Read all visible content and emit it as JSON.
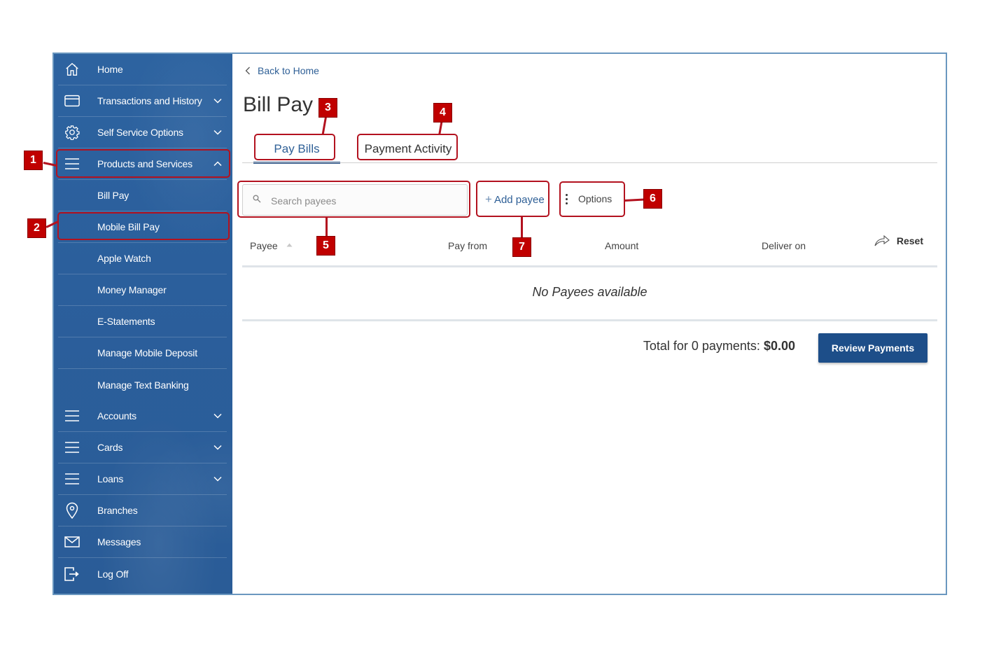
{
  "sidebar": {
    "items": [
      {
        "label": "Home",
        "icon": "home-icon",
        "chevron": null
      },
      {
        "label": "Transactions and History",
        "icon": "card-icon",
        "chevron": "down"
      },
      {
        "label": "Self Service Options",
        "icon": "gear-icon",
        "chevron": "down"
      },
      {
        "label": "Products and Services",
        "icon": "menu-icon",
        "chevron": "up"
      },
      {
        "label": "Bill Pay",
        "icon": null,
        "chevron": null
      },
      {
        "label": "Mobile Bill Pay",
        "icon": null,
        "chevron": null
      },
      {
        "label": "Apple Watch",
        "icon": null,
        "chevron": null
      },
      {
        "label": "Money Manager",
        "icon": null,
        "chevron": null
      },
      {
        "label": "E-Statements",
        "icon": null,
        "chevron": null
      },
      {
        "label": "Manage Mobile Deposit",
        "icon": null,
        "chevron": null
      },
      {
        "label": "Manage Text Banking",
        "icon": null,
        "chevron": null
      },
      {
        "label": "Accounts",
        "icon": "menu-icon",
        "chevron": "down"
      },
      {
        "label": "Cards",
        "icon": "menu-icon",
        "chevron": "down"
      },
      {
        "label": "Loans",
        "icon": "menu-icon",
        "chevron": "down"
      },
      {
        "label": "Branches",
        "icon": "location-pin-icon",
        "chevron": null
      },
      {
        "label": "Messages",
        "icon": "envelope-icon",
        "chevron": null
      },
      {
        "label": "Log Off",
        "icon": "logout-icon",
        "chevron": null
      }
    ]
  },
  "main": {
    "back_link": "Back to Home",
    "title": "Bill Pay",
    "tabs": [
      {
        "label": "Pay Bills",
        "active": true
      },
      {
        "label": "Payment Activity",
        "active": false
      }
    ],
    "search": {
      "placeholder": "Search payees",
      "value": ""
    },
    "add_payee_label": "Add payee",
    "options_label": "Options",
    "reset_label": "Reset",
    "table": {
      "columns": [
        "Payee",
        "Pay from",
        "Amount",
        "Deliver on"
      ],
      "sort_column": "Payee",
      "sort_direction": "ascending",
      "rows": [],
      "empty_message": "No Payees available"
    },
    "total_label": "Total for 0 payments:",
    "total_amount": "$0.00",
    "review_button": "Review Payments"
  },
  "annotations": [
    {
      "number": "1",
      "target": "Products and Services"
    },
    {
      "number": "2",
      "target": "Mobile Bill Pay"
    },
    {
      "number": "3",
      "target": "Pay Bills"
    },
    {
      "number": "4",
      "target": "Payment Activity"
    },
    {
      "number": "5",
      "target": "Search payees"
    },
    {
      "number": "6",
      "target": "Options"
    },
    {
      "number": "7",
      "target": "Add payee"
    }
  ],
  "colors": {
    "sidebar_bg": "#2b5f9c",
    "primary_button": "#1d4e89",
    "link": "#2e5f96",
    "annotation_red": "#c00000"
  }
}
